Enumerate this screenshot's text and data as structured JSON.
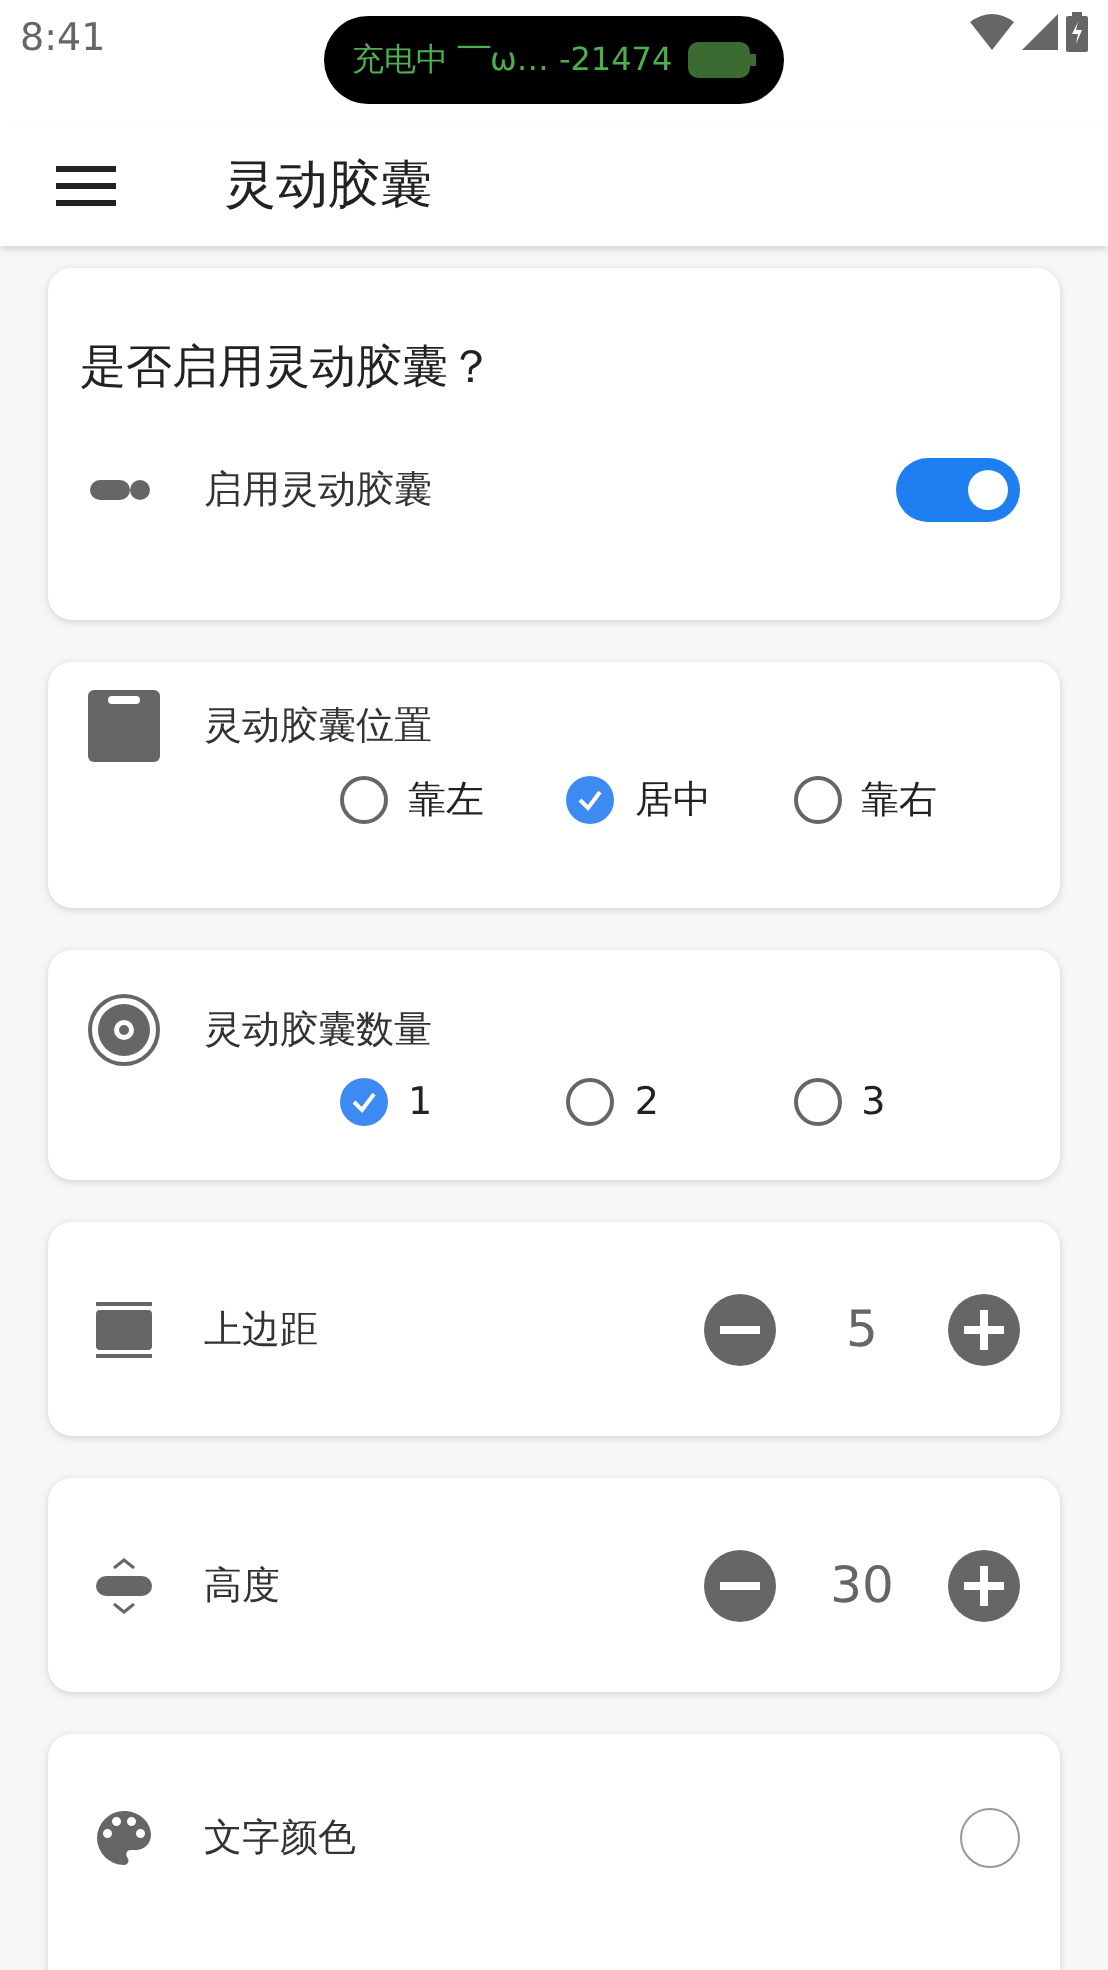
{
  "status_bar": {
    "time": "8:41",
    "island": {
      "text": "充电中 ‾‾ω… -21474"
    }
  },
  "toolbar": {
    "title": "灵动胶囊"
  },
  "cards": [
    {
      "kind": "switch",
      "title": "是否启用灵动胶囊？",
      "label": "启用灵动胶囊",
      "on": true
    },
    {
      "kind": "radio",
      "label": "灵动胶囊位置",
      "options": [
        {
          "label": "靠左",
          "selected": false
        },
        {
          "label": "居中",
          "selected": true
        },
        {
          "label": "靠右",
          "selected": false
        }
      ]
    },
    {
      "kind": "radio",
      "label": "灵动胶囊数量",
      "options": [
        {
          "label": "1",
          "selected": true
        },
        {
          "label": "2",
          "selected": false
        },
        {
          "label": "3",
          "selected": false
        }
      ]
    },
    {
      "kind": "stepper",
      "label": "上边距",
      "value": "5"
    },
    {
      "kind": "stepper",
      "label": "高度",
      "value": "30"
    },
    {
      "kind": "color",
      "label": "文字颜色"
    }
  ]
}
